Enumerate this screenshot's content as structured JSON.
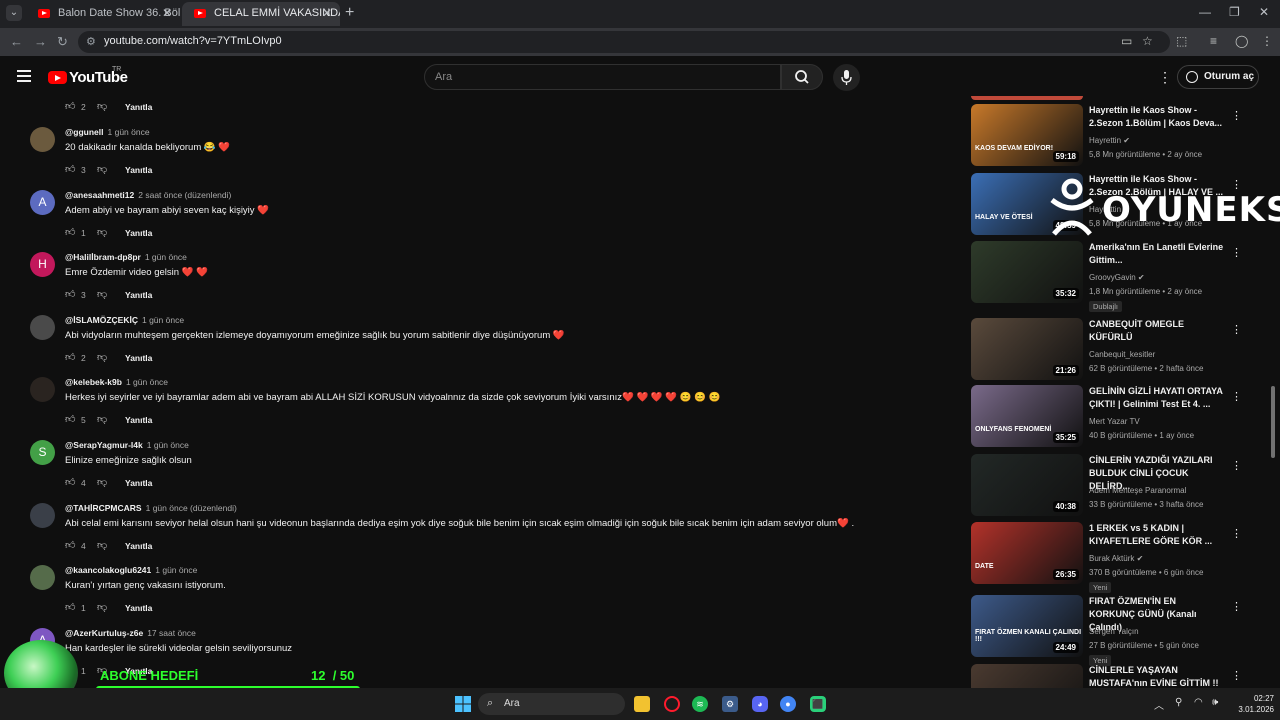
{
  "browser": {
    "tabs": [
      {
        "title": "Balon Date Show 36. Bölüm - Y",
        "active": false
      },
      {
        "title": "CELAL EMMİ VAKASINDA DAVE",
        "active": true
      }
    ],
    "url": "youtube.com/watch?v=7YTmLOIvp0"
  },
  "header": {
    "logo": "YouTube",
    "country": "TR",
    "search_placeholder": "Ara",
    "signin": "Oturum aç"
  },
  "comments": {
    "top_actions": {
      "likes": "2",
      "reply": "Yanıtla"
    },
    "items": [
      {
        "author": "@ggunell",
        "time": "1 gün önce",
        "text": "20 dakikadır kanalda bekliyorum 😂 ❤️",
        "likes": "3",
        "reply": "Yanıtla",
        "avatar_letter": "",
        "avatar_color": "#6b5a3e"
      },
      {
        "author": "@anesaahmeti12",
        "time": "2 saat önce (düzenlendi)",
        "text": "Adem abiyi ve bayram abiyi  seven kaç kişiyiy ❤️",
        "likes": "1",
        "reply": "Yanıtla",
        "avatar_letter": "A",
        "avatar_color": "#5c6bc0"
      },
      {
        "author": "@Halilİbram-dp8pr",
        "time": "1 gün önce",
        "text": "Emre Özdemir video gelsin ❤️ ❤️",
        "likes": "3",
        "reply": "Yanıtla",
        "avatar_letter": "H",
        "avatar_color": "#c2185b"
      },
      {
        "author": "@İSLAMÖZÇEKİÇ",
        "time": "1 gün önce",
        "text": "Abi vidyoların muhteşem gerçekten izlemeye doyamıyorum emeğinize sağlık  bu yorum sabitlenir diye düşünüyorum ❤️",
        "likes": "2",
        "reply": "Yanıtla",
        "avatar_letter": "",
        "avatar_color": "#4a4a4a"
      },
      {
        "author": "@kelebek-k9b",
        "time": "1 gün önce",
        "text": "Herkes iyi seyirler ve iyi bayramlar adem abi ve bayram abi ALLAH SİZİ KORUSUN vidyoalnnız da sizde çok seviyorum İyiki varsınız❤️ ❤️ ❤️ ❤️ 😊 😊 😊",
        "likes": "5",
        "reply": "Yanıtla",
        "avatar_letter": "",
        "avatar_color": "#2a2420"
      },
      {
        "author": "@SerapYagmur-l4k",
        "time": "1 gün önce",
        "text": "Elinize emeğinize sağlık olsun",
        "likes": "4",
        "reply": "Yanıtla",
        "avatar_letter": "S",
        "avatar_color": "#43a047"
      },
      {
        "author": "@TAHİRCPMCARS",
        "time": "1 gün önce (düzenlendi)",
        "text": "Abi celal emi karısını seviyor helal olsun hani şu videonun başlarında dediya eşim yok diye soğuk bile benim için sıcak eşim olmadiği için soğuk bile sıcak benim için adam seviyor olum❤️ .",
        "likes": "4",
        "reply": "Yanıtla",
        "avatar_letter": "",
        "avatar_color": "#3a3f48"
      },
      {
        "author": "@kaancolakoglu6241",
        "time": "1 gün önce",
        "text": "Kuran'ı yırtan genç vakasını istiyorum.",
        "likes": "1",
        "reply": "Yanıtla",
        "avatar_letter": "",
        "avatar_color": "#556b4a"
      },
      {
        "author": "@AzerKurtuluş-z6e",
        "time": "17 saat önce",
        "text": "Han kardeşler ile sürekli videolar gelsin seviliyorsunuz",
        "likes": "1",
        "reply": "Yanıtla",
        "avatar_letter": "A",
        "avatar_color": "#7e57c2"
      }
    ]
  },
  "sidebar": {
    "videos": [
      {
        "title": "Hayrettin ile Kaos Show - 2.Sezon 1.Bölüm | Kaos Deva...",
        "channel": "Hayrettin",
        "verified": true,
        "meta": "5,8 Mn görüntüleme • 2 ay önce",
        "duration": "59:18",
        "badge": "",
        "thumb_text": "KAOS DEVAM EDİYOR!",
        "thumb_color": "#c8792a"
      },
      {
        "title": "Hayrettin ile Kaos Show - 2.Sezon 2.Bölüm | HALAY VE ...",
        "channel": "Hayrettin",
        "verified": true,
        "meta": "5,8 Mn görüntüleme • 1 ay önce",
        "duration": "48:59",
        "badge": "",
        "thumb_text": "HALAY VE ÖTESİ",
        "thumb_color": "#3b6fb6"
      },
      {
        "title": "Amerika'nın En Lanetli Evlerine Gittim...",
        "channel": "GroovyGavin",
        "verified": true,
        "meta": "1,8 Mn görüntüleme • 2 ay önce",
        "duration": "35:32",
        "badge": "Dublajlı",
        "thumb_text": "",
        "thumb_color": "#2e3b2a"
      },
      {
        "title": "CANBEQUİT OMEGLE KÜFÜRLÜ",
        "channel": "Canbequit_kesitler",
        "verified": false,
        "meta": "62 B görüntüleme • 2 hafta önce",
        "duration": "21:26",
        "badge": "",
        "thumb_text": "",
        "thumb_color": "#5a4a3c"
      },
      {
        "title": "GELİNİN GİZLİ HAYATI ORTAYA ÇIKTI! | Gelinimi Test Et 4. ...",
        "channel": "Mert Yazar TV",
        "verified": false,
        "meta": "40 B görüntüleme • 1 ay önce",
        "duration": "35:25",
        "badge": "",
        "thumb_text": "ONLYFANS FENOMENİ",
        "thumb_color": "#7a6a8a"
      },
      {
        "title": "CİNLERİN YAZDIĞI YAZILARI BULDUK CİNLİ ÇOCUK DELİRD...",
        "channel": "Adem Menteşe Paranormal",
        "verified": false,
        "meta": "33 B görüntüleme • 3 hafta önce",
        "duration": "40:38",
        "badge": "",
        "thumb_text": "",
        "thumb_color": "#222826"
      },
      {
        "title": "1 ERKEK vs 5 KADIN | KIYAFETLERE GÖRE KÖR ...",
        "channel": "Burak Aktürk",
        "verified": true,
        "meta": "370 B görüntüleme • 6 gün önce",
        "duration": "26:35",
        "badge": "Yeni",
        "thumb_text": "DATE",
        "thumb_color": "#b3322a"
      },
      {
        "title": "FIRAT ÖZMEN'İN EN KORKUNÇ GÜNÜ (Kanalı Çalındı)",
        "channel": "Sergen Yalçın",
        "verified": false,
        "meta": "27 B görüntüleme • 5 gün önce",
        "duration": "24:49",
        "badge": "Yeni",
        "thumb_text": "FIRAT ÖZMEN KANALI ÇALINDI !!!",
        "thumb_color": "#3d5a8a"
      },
      {
        "title": "CİNLERLE YAŞAYAN MUSTAFA'nın EVİNE GİTTİM !! ...",
        "channel": "",
        "verified": false,
        "meta": "",
        "duration": "",
        "badge": "",
        "thumb_text": "",
        "thumb_color": "#4a3a30"
      }
    ]
  },
  "watermark": "OYUNEKS",
  "overlay": {
    "goal_title": "ABONE HEDEFİ",
    "goal_current": "12",
    "goal_target": "/ 50",
    "goal_progress": 0.24
  },
  "taskbar": {
    "search": "Ara",
    "time": "02:27",
    "date": "3.01.2026"
  },
  "colors": {
    "youtube_red": "#ff0000",
    "goal_green": "#2dff2d",
    "background": "#0f0f0f"
  }
}
